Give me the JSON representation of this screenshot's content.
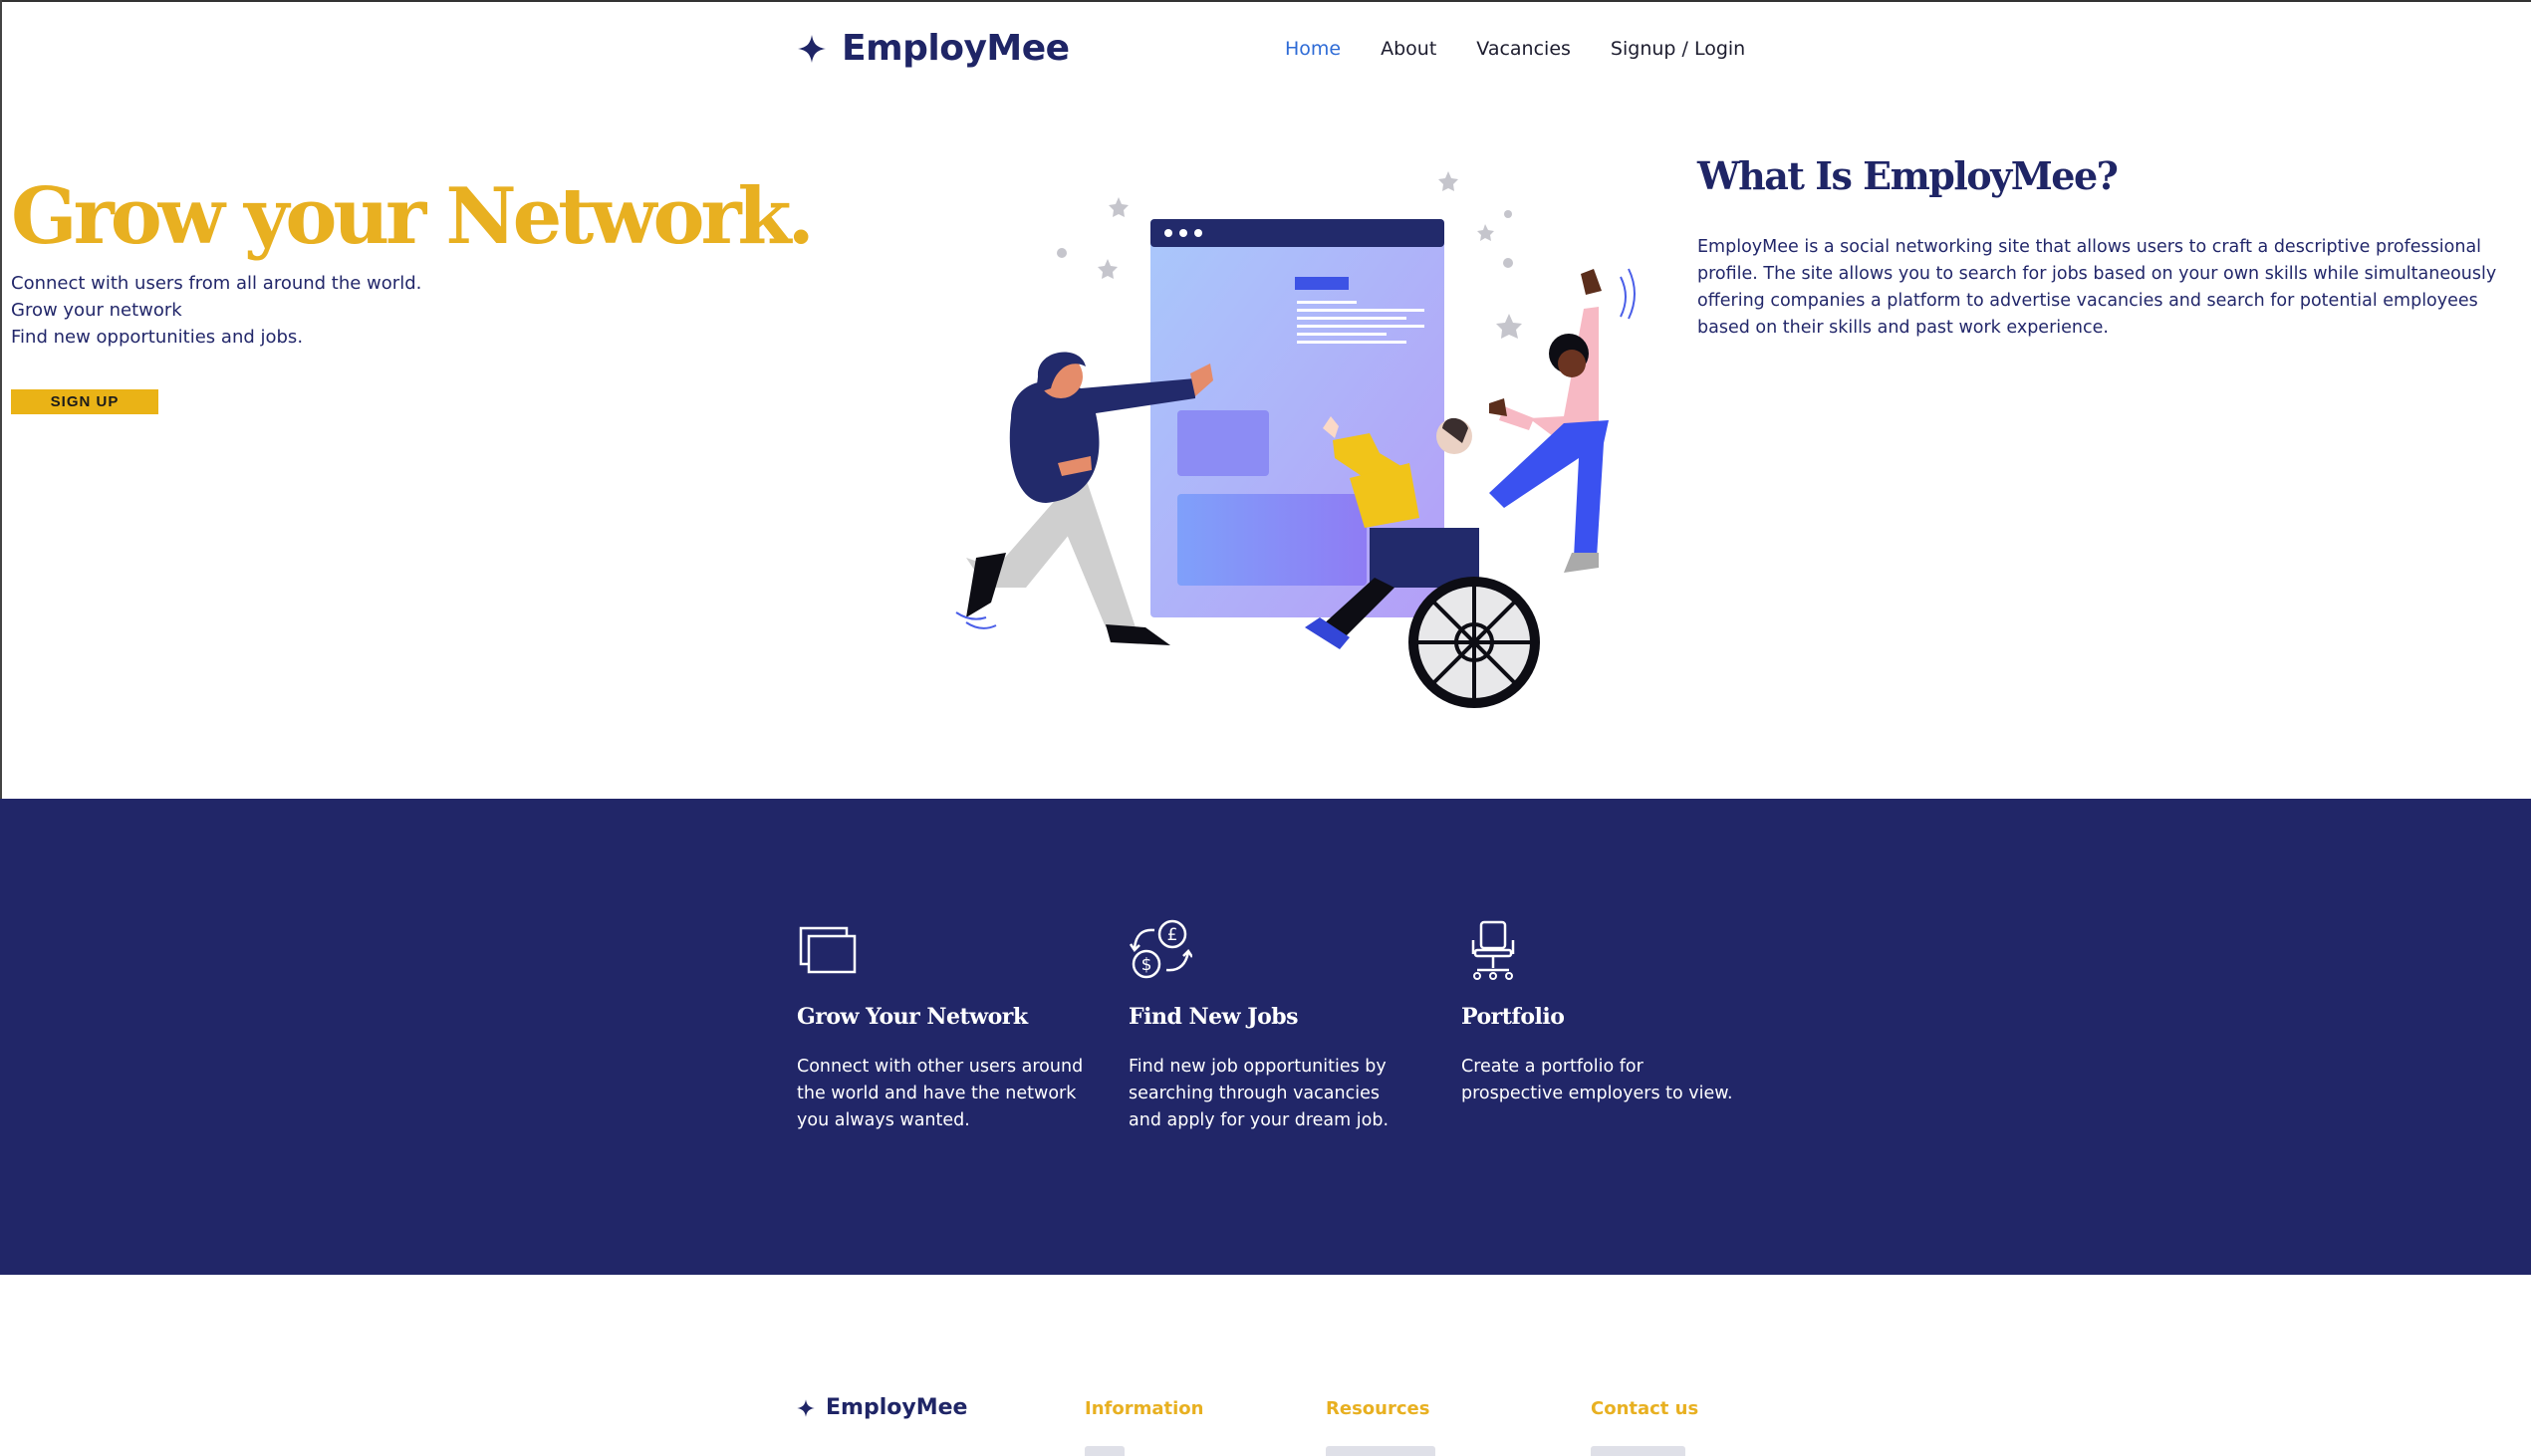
{
  "header": {
    "brand": "EmployMee",
    "nav": [
      {
        "label": "Home",
        "active": true
      },
      {
        "label": "About",
        "active": false
      },
      {
        "label": "Vacancies",
        "active": false
      },
      {
        "label": "Signup / Login",
        "active": false
      }
    ]
  },
  "hero": {
    "title": "Grow your Network.",
    "lines": [
      "Connect with users from all around the world.",
      "Grow your network",
      "Find new opportunities and jobs."
    ],
    "signup_label": "SIGN UP"
  },
  "about": {
    "title": "What Is EmployMee?",
    "text": "EmployMee is a social networking site that allows users to craft a descriptive professional profile. The site allows you to search for jobs based on your own skills while simultaneously offering companies a platform to advertise vacancies and search for potential employees based on their skills and past work experience."
  },
  "features": [
    {
      "icon": "windows-icon",
      "title": "Grow Your Network",
      "text": "Connect with other users around the world and have the network you always wanted."
    },
    {
      "icon": "currency-exchange-icon",
      "title": "Find New Jobs",
      "text": "Find new job opportunities by searching through vacancies and apply for your dream job."
    },
    {
      "icon": "office-chair-icon",
      "title": "Portfolio",
      "text": "Create a portfolio for prospective employers to view."
    }
  ],
  "footer": {
    "brand": "EmployMee",
    "columns": [
      "Information",
      "Resources",
      "Contact us"
    ]
  },
  "colors": {
    "navy": "#212668",
    "accent_yellow": "#e8b021",
    "link_blue": "#2e6bd6"
  }
}
